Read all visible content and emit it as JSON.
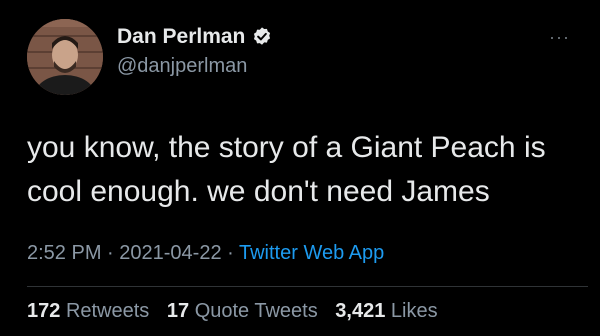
{
  "author": {
    "display_name": "Dan Perlman",
    "handle": "@danjperlman",
    "verified": true,
    "verified_color": "#1d9bf0"
  },
  "more_icon": "···",
  "tweet": {
    "text": "you know, the story of a Giant Peach is\ncool enough. we don't need James"
  },
  "meta": {
    "time": "2:52 PM",
    "sep1": " · ",
    "date": "2021-04-22",
    "sep2": " · ",
    "source": "Twitter Web App"
  },
  "stats": {
    "retweets_count": "172",
    "retweets_label": "Retweets",
    "quotes_count": "17",
    "quotes_label": "Quote Tweets",
    "likes_count": "3,421",
    "likes_label": "Likes"
  },
  "colors": {
    "background": "#000000",
    "text": "#e7e9ea",
    "secondary": "#8b98a5",
    "link": "#1d9bf0"
  }
}
